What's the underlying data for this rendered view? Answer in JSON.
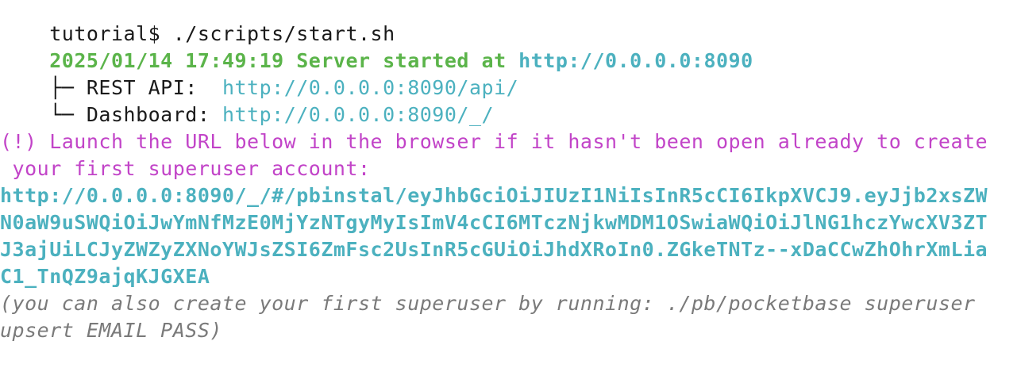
{
  "prompt": {
    "text": "tutorial$ ./scripts/start.sh"
  },
  "server": {
    "timestamp_msg": "2025/01/14 17:49:19 Server started at ",
    "url": "http://0.0.0.0:8090",
    "rest_prefix": "├─ REST API:  ",
    "rest_url": "http://0.0.0.0:8090/api/",
    "dash_prefix": "└─ Dashboard: ",
    "dash_url": "http://0.0.0.0:8090/_/"
  },
  "notice": {
    "line1": "(!) Launch the URL below in the browser if it hasn't been open already to create",
    "line2": " your first superuser account:"
  },
  "install_url": {
    "line1": "http://0.0.0.0:8090/_/#/pbinstal/eyJhbGciOiJIUzI1NiIsInR5cCI6IkpXVCJ9.eyJjb2xsZW",
    "line2": "N0aW9uSWQiOiJwYmNfMzE0MjYzNTgyMyIsImV4cCI6MTczNjkwMDM1OSwiaWQiOiJlNG1hczYwcXV3ZT",
    "line3": "J3ajUiLCJyZWZyZXNoYWJsZSI6ZmFsc2UsInR5cGUiOiJhdXRoIn0.ZGkeTNTz--xDaCCwZhOhrXmLia",
    "line4": "C1_TnQZ9ajqKJGXEA"
  },
  "hint": {
    "line1": "(you can also create your first superuser by running: ./pb/pocketbase superuser",
    "line2": "upsert EMAIL PASS)"
  },
  "colors": {
    "green": "#5bb44a",
    "cyan": "#4cb1bf",
    "magenta": "#c244c8",
    "gray": "#7a7a7a"
  }
}
